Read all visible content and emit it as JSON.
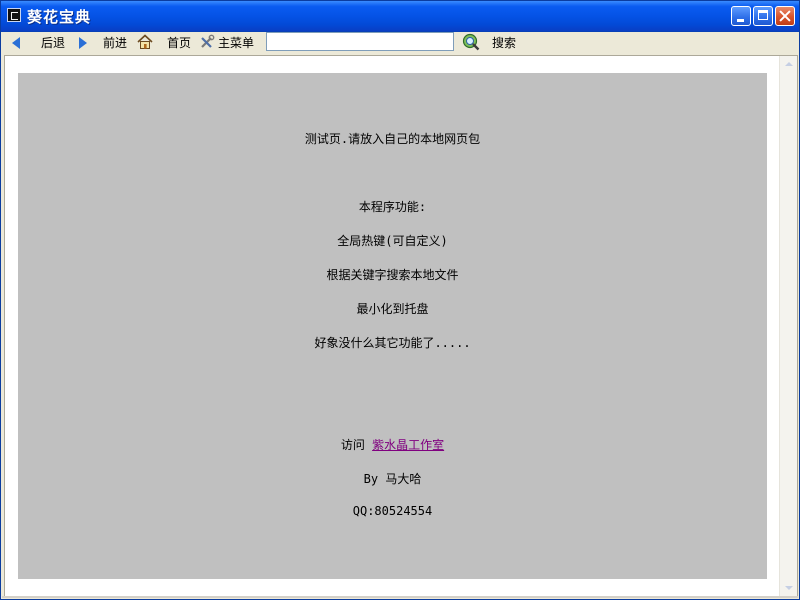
{
  "window": {
    "title": "葵花宝典"
  },
  "toolbar": {
    "back_label": "后退",
    "forward_label": "前进",
    "home_label": "首页",
    "menu_label": "主菜单",
    "search_value": "",
    "search_label": "搜索"
  },
  "content": {
    "test_line": "测试页.请放入自己的本地网页包",
    "features_heading": "本程序功能:",
    "feature_1": "全局热键(可自定义)",
    "feature_2": "根据关键字搜索本地文件",
    "feature_3": "最小化到托盘",
    "feature_4": "好象没什么其它功能了.....",
    "visit_label": "访问",
    "studio_link": "紫水晶工作室",
    "author": "By 马大哈",
    "qq": "QQ:80524554"
  },
  "colors": {
    "titlebar": "#0553e6",
    "page_background": "#c0c0c0",
    "link": "#800080"
  }
}
